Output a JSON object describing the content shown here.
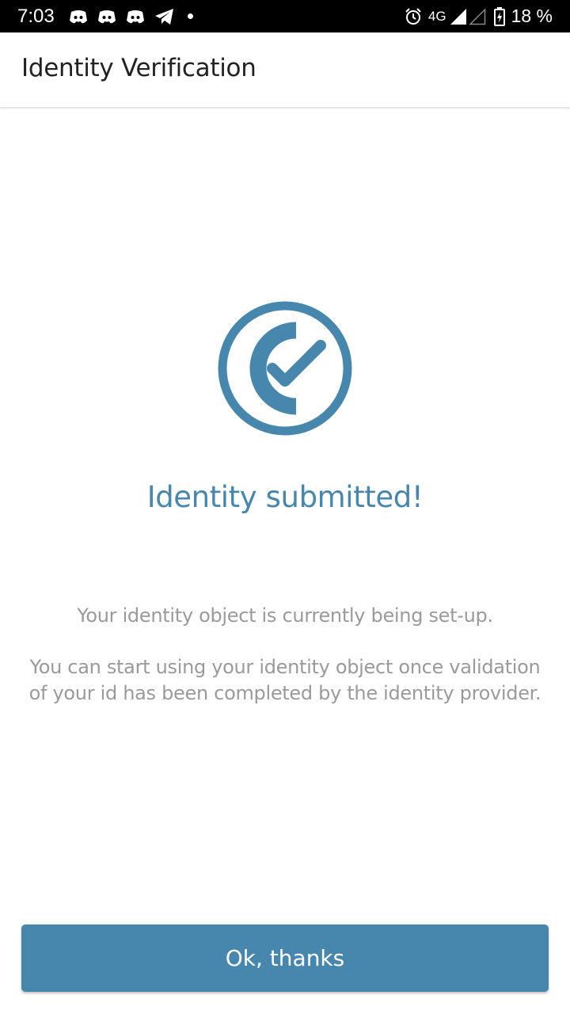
{
  "status_bar": {
    "time": "7:03",
    "notification_icons": [
      "discord-icon",
      "discord-icon",
      "discord-icon",
      "telegram-icon"
    ],
    "network": "4G",
    "battery": "18 %"
  },
  "app_bar": {
    "title": "Identity Verification"
  },
  "content": {
    "headline": "Identity submitted!",
    "message_1": "Your identity object is currently being set-up.",
    "message_2": "You can start using your identity object once validation of your id has been completed by the identity provider."
  },
  "button": {
    "label": "Ok, thanks"
  },
  "colors": {
    "accent": "#4787ae",
    "body_text": "#9a9a9a",
    "title_text": "#222222",
    "status_bar": "#000000"
  }
}
